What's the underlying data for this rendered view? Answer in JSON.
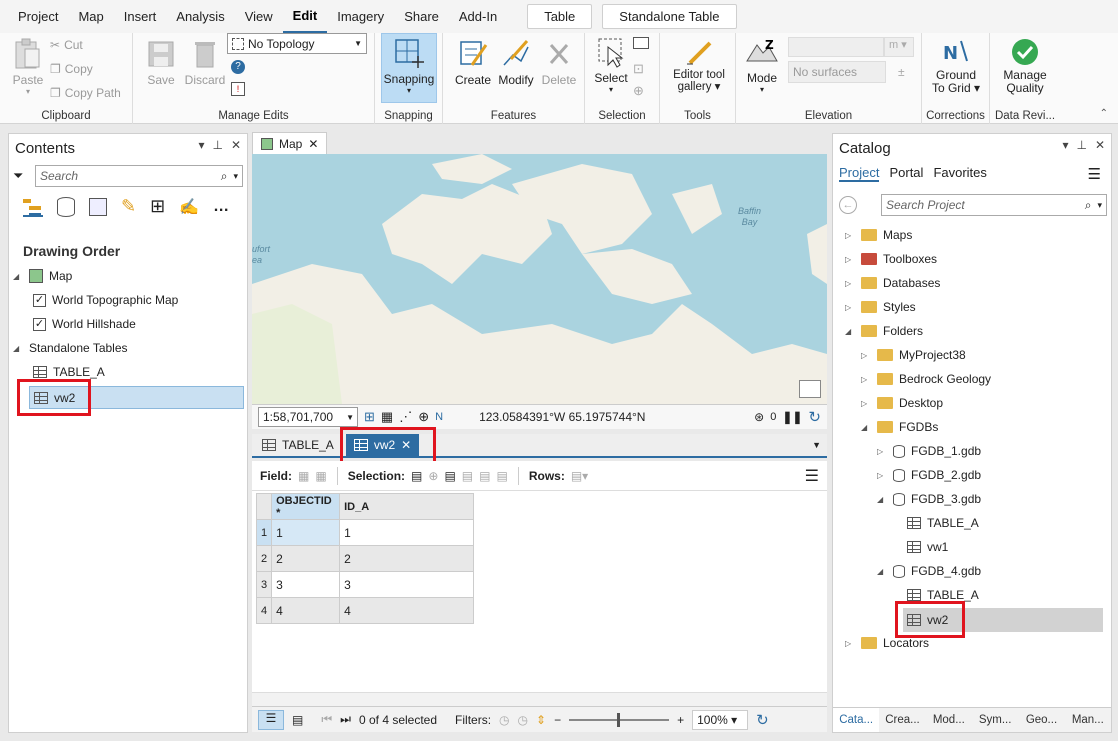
{
  "menu": {
    "items": [
      "Project",
      "Map",
      "Insert",
      "Analysis",
      "View",
      "Edit",
      "Imagery",
      "Share",
      "Add-In"
    ],
    "active": "Edit",
    "context_tabs": [
      "Table",
      "Standalone Table"
    ]
  },
  "ribbon": {
    "clipboard": {
      "label": "Clipboard",
      "paste": "Paste",
      "cut": "Cut",
      "copy": "Copy",
      "copy_path": "Copy Path"
    },
    "manage_edits": {
      "label": "Manage Edits",
      "save": "Save",
      "discard": "Discard",
      "topology": "No Topology"
    },
    "snapping": {
      "label": "Snapping",
      "button": "Snapping"
    },
    "features": {
      "label": "Features",
      "create": "Create",
      "modify": "Modify",
      "delete": "Delete"
    },
    "selection": {
      "label": "Selection",
      "select": "Select"
    },
    "tools": {
      "label": "Tools",
      "gallery_line1": "Editor tool",
      "gallery_line2": "gallery"
    },
    "elevation": {
      "label": "Elevation",
      "mode": "Mode",
      "surfaces": "No surfaces",
      "unit": "m"
    },
    "corrections": {
      "label": "Corrections",
      "ground_line1": "Ground",
      "ground_line2": "To Grid"
    },
    "data_review": {
      "label": "Data Revi...",
      "manage_line1": "Manage",
      "manage_line2": "Quality"
    }
  },
  "contents": {
    "title": "Contents",
    "search_placeholder": "Search",
    "drawing_order": "Drawing Order",
    "map": "Map",
    "layers": [
      "World Topographic Map",
      "World Hillshade"
    ],
    "standalone_tables": "Standalone Tables",
    "tables": [
      "TABLE_A",
      "vw2"
    ]
  },
  "map_view": {
    "tab": "Map",
    "scale": "1:58,701,700",
    "coords": "123.0584391°W 65.1975744°N",
    "labels": {
      "baffin1": "Baffin",
      "baffin2": "Bay",
      "beaufort1": "ufort",
      "beaufort2": "ea"
    },
    "selected_count": "0"
  },
  "table_view": {
    "tabs": [
      "TABLE_A",
      "vw2"
    ],
    "field_label": "Field:",
    "selection_label": "Selection:",
    "rows_label": "Rows:",
    "columns": [
      "OBJECTID *",
      "ID_A"
    ],
    "rows": [
      {
        "n": "1",
        "objectid": "1",
        "id_a": "1"
      },
      {
        "n": "2",
        "objectid": "2",
        "id_a": "2"
      },
      {
        "n": "3",
        "objectid": "3",
        "id_a": "3"
      },
      {
        "n": "4",
        "objectid": "4",
        "id_a": "4"
      }
    ],
    "status": "0 of 4 selected",
    "filters": "Filters:",
    "zoom": "100%"
  },
  "catalog": {
    "title": "Catalog",
    "tabs": [
      "Project",
      "Portal",
      "Favorites"
    ],
    "search_placeholder": "Search Project",
    "items": [
      "Maps",
      "Toolboxes",
      "Databases",
      "Styles",
      "Folders"
    ],
    "folders": [
      "MyProject38",
      "Bedrock Geology",
      "Desktop",
      "FGDBs"
    ],
    "gdbs": [
      "FGDB_1.gdb",
      "FGDB_2.gdb",
      "FGDB_3.gdb"
    ],
    "gdb3_items": [
      "TABLE_A",
      "vw1"
    ],
    "gdb4": "FGDB_4.gdb",
    "gdb4_items": [
      "TABLE_A",
      "vw2"
    ],
    "locators": "Locators",
    "bottom_tabs": [
      "Cata...",
      "Crea...",
      "Mod...",
      "Sym...",
      "Geo...",
      "Man..."
    ]
  }
}
